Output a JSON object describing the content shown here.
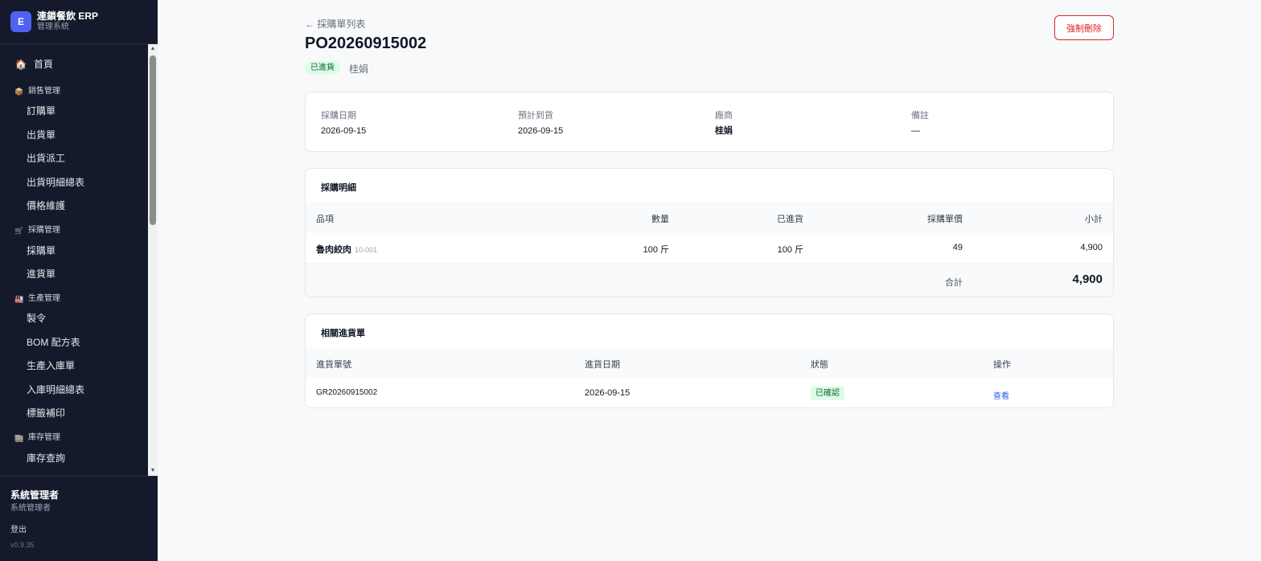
{
  "brand": {
    "badge": "E",
    "title": "連鎖餐飲 ERP",
    "subtitle": "管理系統"
  },
  "sidebar": {
    "home": {
      "icon": "house-icon",
      "label": "首頁"
    },
    "sections": [
      {
        "icon": "box-icon",
        "label": "銷售管理",
        "items": [
          "訂購單",
          "出貨單",
          "出貨派工",
          "出貨明細總表",
          "價格維護"
        ]
      },
      {
        "icon": "cart-icon",
        "label": "採購管理",
        "items": [
          "採購單",
          "進貨單"
        ]
      },
      {
        "icon": "factory-icon",
        "label": "生產管理",
        "items": [
          "製令",
          "BOM 配方表",
          "生產入庫單",
          "入庫明細總表",
          "標籤補印"
        ]
      },
      {
        "icon": "warehouse-icon",
        "label": "庫存管理",
        "items": [
          "庫存查詢"
        ]
      }
    ]
  },
  "user": {
    "name": "系統管理者",
    "role": "系統管理者",
    "logout": "登出",
    "version": "v0.9.35"
  },
  "header": {
    "back": "← 採購單列表",
    "po_number": "PO20260915002",
    "status": "已進貨",
    "vendor": "桂娟",
    "delete": "強制刪除"
  },
  "info": {
    "purchase_date_label": "採購日期",
    "purchase_date": "2026-09-15",
    "expected_label": "預計到貨",
    "expected": "2026-09-15",
    "vendor_label": "廠商",
    "vendor": "桂娟",
    "note_label": "備註",
    "note": "—"
  },
  "detail": {
    "title": "採購明細",
    "columns": [
      "品項",
      "數量",
      "已進貨",
      "採購單價",
      "小計"
    ],
    "rows": [
      {
        "name": "魯肉絞肉",
        "code": "10-001",
        "qty": "100 斤",
        "received": "100 斤",
        "price": "49",
        "subtotal": "4,900"
      }
    ],
    "total_label": "合計",
    "total": "4,900"
  },
  "receipts": {
    "title": "相關進貨單",
    "columns": [
      "進貨單號",
      "進貨日期",
      "狀態",
      "操作"
    ],
    "rows": [
      {
        "number": "GR20260915002",
        "date": "2026-09-15",
        "status": "已確認",
        "action": "查看"
      }
    ]
  },
  "colors": {
    "sidebar_bg": "#141a2b",
    "accent": "#4f63f0",
    "danger": "#dc2626",
    "success_bg": "#dcfce7",
    "success_text": "#166534",
    "link": "#2563eb"
  }
}
